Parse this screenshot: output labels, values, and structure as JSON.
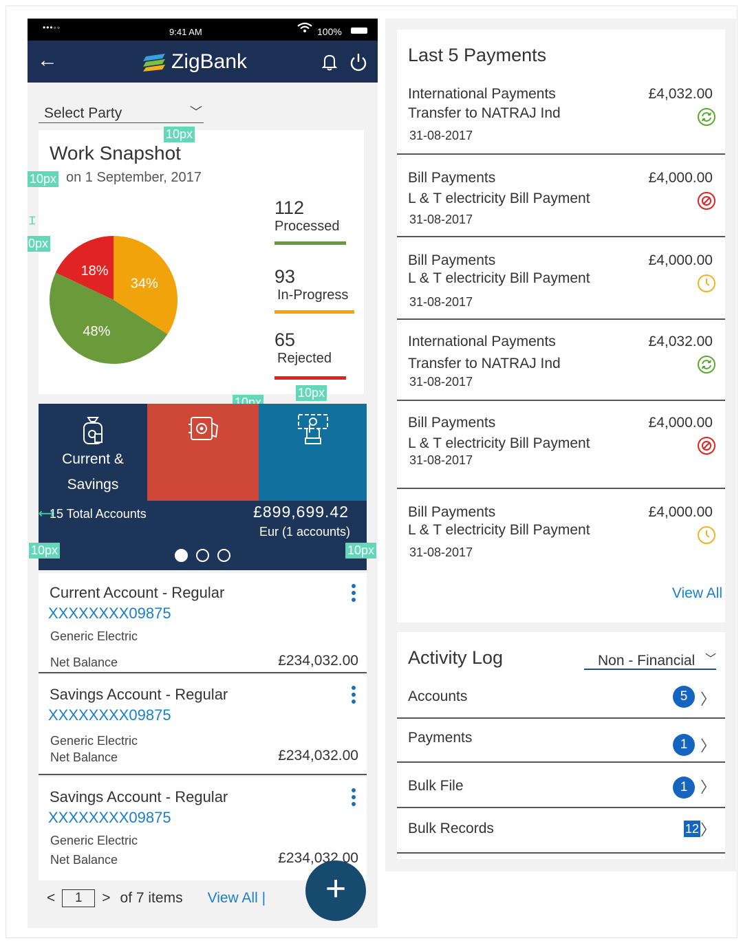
{
  "status_bar": {
    "signal": "•••◦◦",
    "time": "9:41 AM",
    "battery": "100%"
  },
  "header": {
    "app_name": "ZigBank",
    "back_icon": "arrow-left-icon",
    "bell_icon": "bell-icon",
    "power_icon": "power-icon"
  },
  "party": {
    "label": "Select Party"
  },
  "snapshot": {
    "title": "Work Snapshot",
    "date": "on 1 September, 2017",
    "stats": [
      {
        "count": "112",
        "label": "Processed",
        "color": "#6b9a3a"
      },
      {
        "count": "93",
        "label": "In-Progress",
        "color": "#f0a30a"
      },
      {
        "count": "65",
        "label": "Rejected",
        "color": "#e02323"
      }
    ]
  },
  "chart_data": {
    "type": "pie",
    "categories": [
      "18%",
      "34%",
      "48%"
    ],
    "values": [
      18,
      34,
      48
    ],
    "colors": [
      "#e02323",
      "#f0a30a",
      "#6b9a3a"
    ],
    "title": ""
  },
  "spec_labels": [
    "10px",
    "10px",
    "10px",
    "10px",
    "10px",
    "10px",
    "10px"
  ],
  "carousel": {
    "tile_label": "Current & Savings",
    "tile_label_line1": "Current &",
    "tile_label_line2": "Savings",
    "total": "15 Total Accounts",
    "amount": "£899,699.42",
    "currency_note": "Eur (1 accounts)",
    "active_page": 1,
    "pages": 3
  },
  "accounts": [
    {
      "name": "Current Account - Regular",
      "number": "XXXXXXXX09875",
      "company": "Generic Electric",
      "net_label": "Net Balance",
      "balance": "£234,032.00"
    },
    {
      "name": "Savings Account - Regular",
      "number": "XXXXXXXX09875",
      "company": "Generic Electric",
      "net_label": "Net Balance",
      "balance": "£234,032.00"
    },
    {
      "name": "Savings Account - Regular",
      "number": "XXXXXXXX09875",
      "company": "Generic Electric",
      "net_label": "Net Balance",
      "balance": "£234,032.00"
    }
  ],
  "pager": {
    "prev": "<",
    "page": "1",
    "next": ">",
    "of_text": "of 7 items",
    "view_all": "View All |"
  },
  "fab": {
    "label": "+"
  },
  "payments": {
    "title": "Last 5 Payments",
    "view_all": "View All",
    "items": [
      {
        "type": "International Payments",
        "desc": "Transfer to NATRAJ Ind",
        "date": "31-08-2017",
        "amount": "£4,032.00",
        "status_icon": "refresh-icon",
        "status_color": "#5aa832"
      },
      {
        "type": "Bill Payments",
        "desc": "L & T electricity Bill Payment",
        "date": "31-08-2017",
        "amount": "£4,000.00",
        "status_icon": "blocked-icon",
        "status_color": "#e02323"
      },
      {
        "type": "Bill Payments",
        "desc": "L & T electricity Bill Payment",
        "date": "31-08-2017",
        "amount": "£4,000.00",
        "status_icon": "clock-icon",
        "status_color": "#f0b323"
      },
      {
        "type": "International Payments",
        "desc": "Transfer to NATRAJ Ind",
        "date": "31-08-2017",
        "amount": "£4,032.00",
        "status_icon": "refresh-icon",
        "status_color": "#5aa832"
      },
      {
        "type": "Bill Payments",
        "desc": "L & T electricity Bill Payment",
        "date": "31-08-2017",
        "amount": "£4,000.00",
        "status_icon": "blocked-icon",
        "status_color": "#e02323"
      },
      {
        "type": "Bill Payments",
        "desc": "L & T electricity Bill Payment",
        "date": "31-08-2017",
        "amount": "£4,000.00",
        "status_icon": "clock-icon",
        "status_color": "#f0b323"
      }
    ]
  },
  "activity_log": {
    "title": "Activity Log",
    "filter": "Non - Financial",
    "rows": [
      {
        "label": "Accounts",
        "count": "5"
      },
      {
        "label": "Payments",
        "count": "1"
      },
      {
        "label": "Bulk File",
        "count": "1"
      },
      {
        "label": "Bulk Records",
        "count": "12"
      }
    ]
  }
}
